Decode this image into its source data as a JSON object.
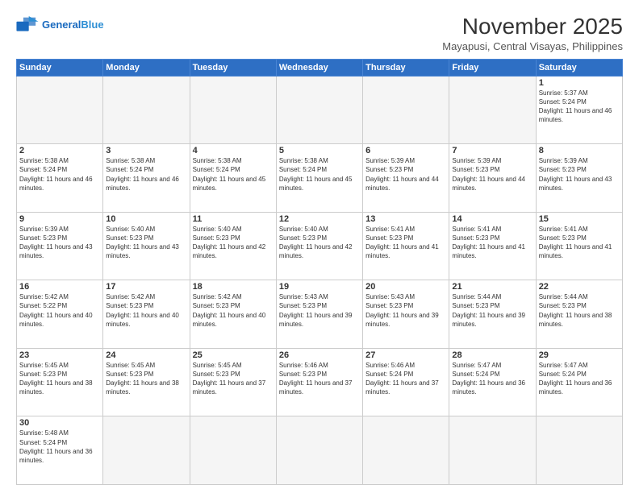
{
  "header": {
    "logo_general": "General",
    "logo_blue": "Blue",
    "month_title": "November 2025",
    "location": "Mayapusi, Central Visayas, Philippines"
  },
  "weekdays": [
    "Sunday",
    "Monday",
    "Tuesday",
    "Wednesday",
    "Thursday",
    "Friday",
    "Saturday"
  ],
  "days": {
    "1": {
      "sunrise": "5:37 AM",
      "sunset": "5:24 PM",
      "daylight": "11 hours and 46 minutes."
    },
    "2": {
      "sunrise": "5:38 AM",
      "sunset": "5:24 PM",
      "daylight": "11 hours and 46 minutes."
    },
    "3": {
      "sunrise": "5:38 AM",
      "sunset": "5:24 PM",
      "daylight": "11 hours and 46 minutes."
    },
    "4": {
      "sunrise": "5:38 AM",
      "sunset": "5:24 PM",
      "daylight": "11 hours and 45 minutes."
    },
    "5": {
      "sunrise": "5:38 AM",
      "sunset": "5:24 PM",
      "daylight": "11 hours and 45 minutes."
    },
    "6": {
      "sunrise": "5:39 AM",
      "sunset": "5:23 PM",
      "daylight": "11 hours and 44 minutes."
    },
    "7": {
      "sunrise": "5:39 AM",
      "sunset": "5:23 PM",
      "daylight": "11 hours and 44 minutes."
    },
    "8": {
      "sunrise": "5:39 AM",
      "sunset": "5:23 PM",
      "daylight": "11 hours and 43 minutes."
    },
    "9": {
      "sunrise": "5:39 AM",
      "sunset": "5:23 PM",
      "daylight": "11 hours and 43 minutes."
    },
    "10": {
      "sunrise": "5:40 AM",
      "sunset": "5:23 PM",
      "daylight": "11 hours and 43 minutes."
    },
    "11": {
      "sunrise": "5:40 AM",
      "sunset": "5:23 PM",
      "daylight": "11 hours and 42 minutes."
    },
    "12": {
      "sunrise": "5:40 AM",
      "sunset": "5:23 PM",
      "daylight": "11 hours and 42 minutes."
    },
    "13": {
      "sunrise": "5:41 AM",
      "sunset": "5:23 PM",
      "daylight": "11 hours and 41 minutes."
    },
    "14": {
      "sunrise": "5:41 AM",
      "sunset": "5:23 PM",
      "daylight": "11 hours and 41 minutes."
    },
    "15": {
      "sunrise": "5:41 AM",
      "sunset": "5:23 PM",
      "daylight": "11 hours and 41 minutes."
    },
    "16": {
      "sunrise": "5:42 AM",
      "sunset": "5:22 PM",
      "daylight": "11 hours and 40 minutes."
    },
    "17": {
      "sunrise": "5:42 AM",
      "sunset": "5:23 PM",
      "daylight": "11 hours and 40 minutes."
    },
    "18": {
      "sunrise": "5:42 AM",
      "sunset": "5:23 PM",
      "daylight": "11 hours and 40 minutes."
    },
    "19": {
      "sunrise": "5:43 AM",
      "sunset": "5:23 PM",
      "daylight": "11 hours and 39 minutes."
    },
    "20": {
      "sunrise": "5:43 AM",
      "sunset": "5:23 PM",
      "daylight": "11 hours and 39 minutes."
    },
    "21": {
      "sunrise": "5:44 AM",
      "sunset": "5:23 PM",
      "daylight": "11 hours and 39 minutes."
    },
    "22": {
      "sunrise": "5:44 AM",
      "sunset": "5:23 PM",
      "daylight": "11 hours and 38 minutes."
    },
    "23": {
      "sunrise": "5:45 AM",
      "sunset": "5:23 PM",
      "daylight": "11 hours and 38 minutes."
    },
    "24": {
      "sunrise": "5:45 AM",
      "sunset": "5:23 PM",
      "daylight": "11 hours and 38 minutes."
    },
    "25": {
      "sunrise": "5:45 AM",
      "sunset": "5:23 PM",
      "daylight": "11 hours and 37 minutes."
    },
    "26": {
      "sunrise": "5:46 AM",
      "sunset": "5:23 PM",
      "daylight": "11 hours and 37 minutes."
    },
    "27": {
      "sunrise": "5:46 AM",
      "sunset": "5:24 PM",
      "daylight": "11 hours and 37 minutes."
    },
    "28": {
      "sunrise": "5:47 AM",
      "sunset": "5:24 PM",
      "daylight": "11 hours and 36 minutes."
    },
    "29": {
      "sunrise": "5:47 AM",
      "sunset": "5:24 PM",
      "daylight": "11 hours and 36 minutes."
    },
    "30": {
      "sunrise": "5:48 AM",
      "sunset": "5:24 PM",
      "daylight": "11 hours and 36 minutes."
    }
  },
  "labels": {
    "sunrise": "Sunrise:",
    "sunset": "Sunset:",
    "daylight": "Daylight:"
  }
}
